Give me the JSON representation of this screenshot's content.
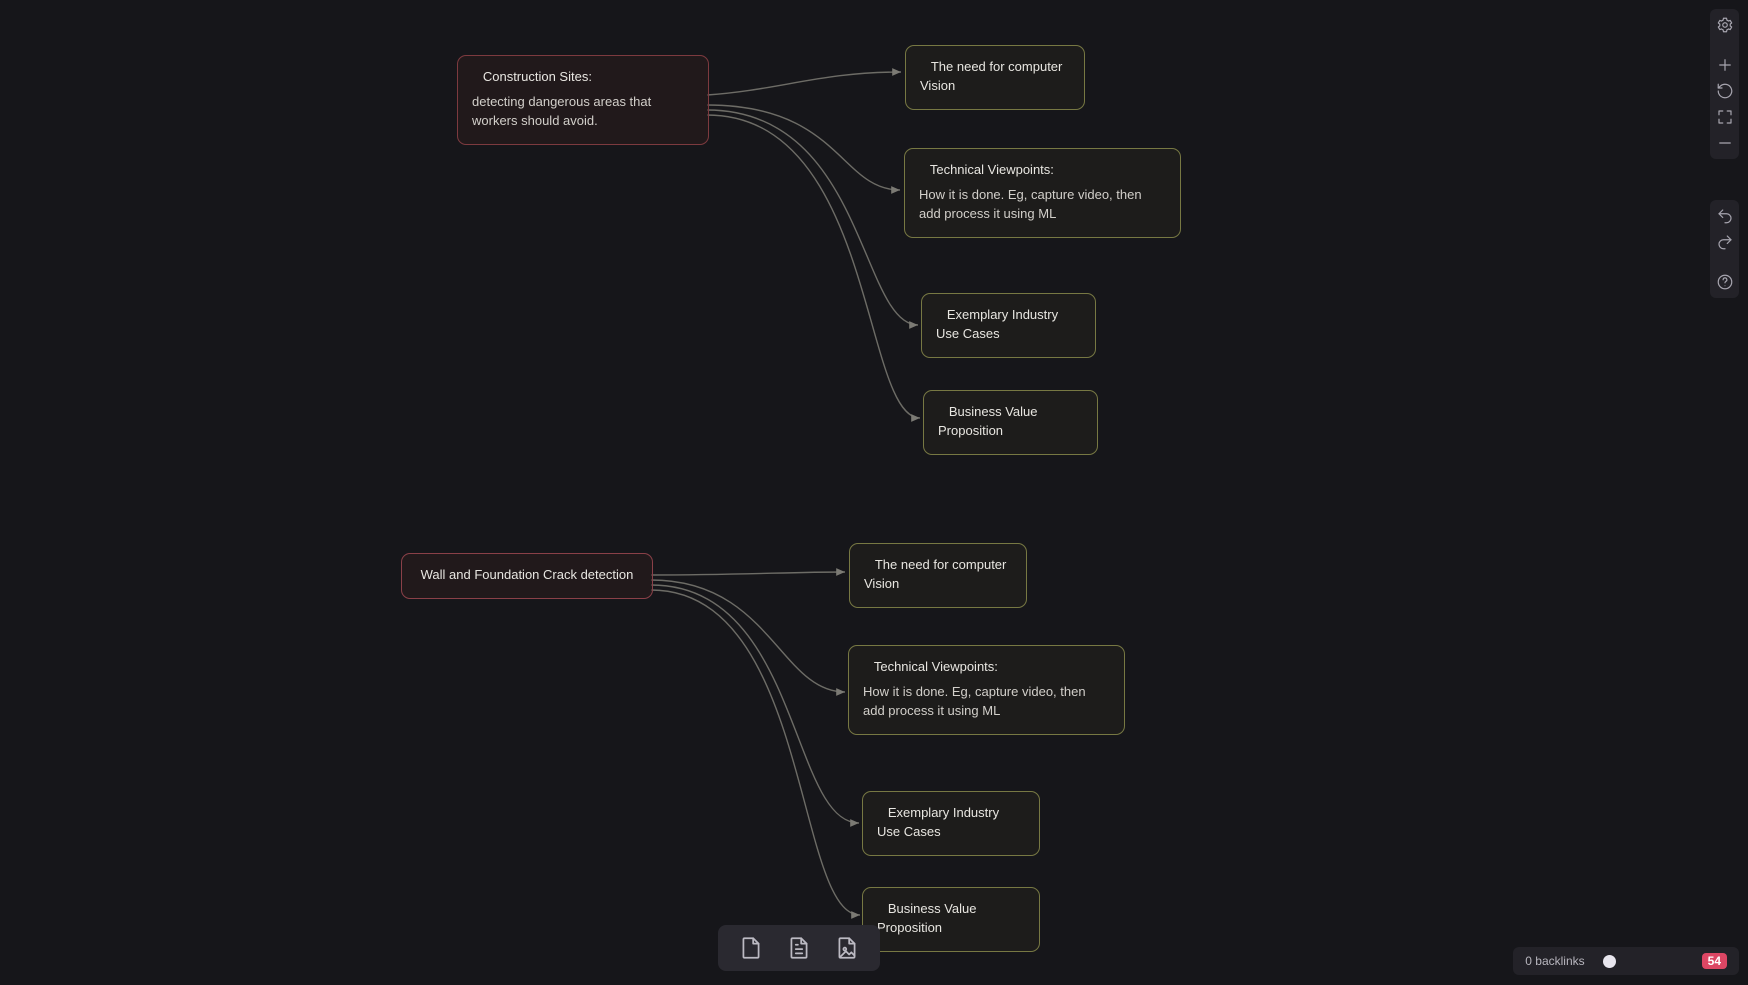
{
  "nodes": {
    "p1_title": "Construction Sites:",
    "p1_body": "detecting dangerous areas that workers should avoid.",
    "p2_title": "Wall and Foundation Crack detection",
    "c_need": "The need for computer Vision",
    "c_tech_title": "Technical Viewpoints:",
    "c_tech_body": "How it is done. Eg, capture video, then add process it using ML",
    "c_cases": "Exemplary Industry Use Cases",
    "c_value": "Business Value Proposition"
  },
  "footer": {
    "backlinks": "0 backlinks",
    "count": "54"
  }
}
